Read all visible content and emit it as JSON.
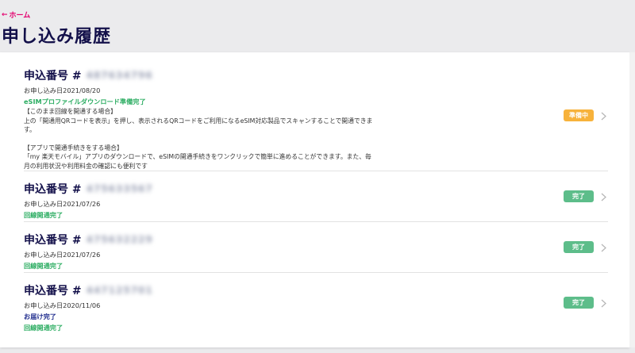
{
  "nav": {
    "home_label": "ホーム"
  },
  "page": {
    "title": "申し込み履歴"
  },
  "applications": [
    {
      "number_label": "申込番号 #",
      "number_masked": "487634796",
      "date": "お申し込み日2021/08/20",
      "status_lines": [
        "eSIMプロファイルダウンロード準備完了"
      ],
      "description": [
        "【このまま回線を開通する場合】",
        "上の「開通用QRコードを表示」を押し、表示されるQRコードをご利用になるeSIM対応製品でスキャンすることで開通できます。",
        "",
        "【アプリで開通手続きをする場合】",
        "「my 楽天モバイル」アプリのダウンロードで、eSIMの開通手続きをワンクリックで簡単に進めることができます。また、毎月の利用状況や利用料金の確認にも便利です"
      ],
      "badge": "準備中",
      "badge_kind": "prep"
    },
    {
      "number_label": "申込番号 #",
      "number_masked": "475633567",
      "date": "お申し込み日2021/07/26",
      "status_lines": [
        "回線開通完了"
      ],
      "badge": "完了",
      "badge_kind": "done"
    },
    {
      "number_label": "申込番号 #",
      "number_masked": "475632229",
      "date": "お申し込み日2021/07/26",
      "status_lines": [
        "回線開通完了"
      ],
      "badge": "完了",
      "badge_kind": "done"
    },
    {
      "number_label": "申込番号 #",
      "number_masked": "447125701",
      "date": "お申し込み日2020/11/06",
      "status_lines_blue": [
        "お届け完了"
      ],
      "status_lines": [
        "回線開通完了"
      ],
      "badge": "完了",
      "badge_kind": "done"
    }
  ],
  "colors": {
    "accent": "#e4006e",
    "title": "#13104a",
    "status_green": "#2cad62",
    "status_blue": "#1d2a8c",
    "badge_done": "#5dbd8a",
    "badge_prep": "#f7b23b"
  }
}
